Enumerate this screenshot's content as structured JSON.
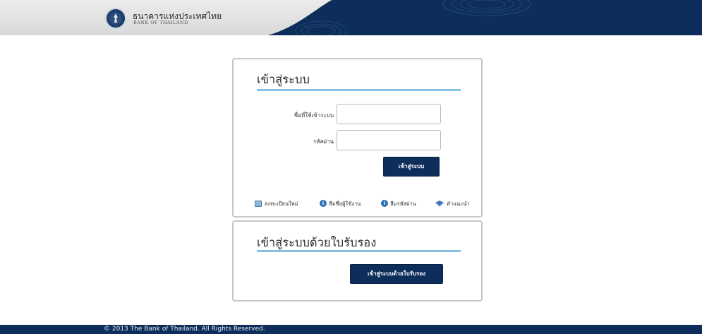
{
  "header": {
    "logo_thai": "ธนาคารแห่งประเทศไทย",
    "logo_english": "BANK OF THAILAND",
    "icon": "bank-seal-icon",
    "colors": {
      "navy": "#0d2e5a",
      "light": "#e6e6e6"
    }
  },
  "login": {
    "title": "เข้าสู่ระบบ",
    "username_label": "ชื่อที่ใช้เข้าระบบ",
    "username_value": "",
    "password_label": "รหัสผ่าน",
    "password_value": "",
    "submit_label": "เข้าสู่ระบบ",
    "links": [
      {
        "label": "ลงทะเบียนใหม่",
        "icon": "register-icon"
      },
      {
        "label": "ลืมชื่อผู้ใช้งาน",
        "icon": "help-icon"
      },
      {
        "label": "ลืมรหัสผ่าน",
        "icon": "help-icon"
      },
      {
        "label": "คำแนะนำ",
        "icon": "guide-icon"
      }
    ]
  },
  "certificate": {
    "title": "เข้าสู่ระบบด้วยใบรับรอง",
    "submit_label": "เข้าสู่ระบบด้วยใบรับรอง"
  },
  "footer": {
    "copyright": "© 2013 The Bank of Thailand. All Rights Reserved."
  },
  "colors": {
    "accent_line": "#86c1e3",
    "button": "#0d2e5a",
    "panel_border": "#c6c6c6"
  }
}
